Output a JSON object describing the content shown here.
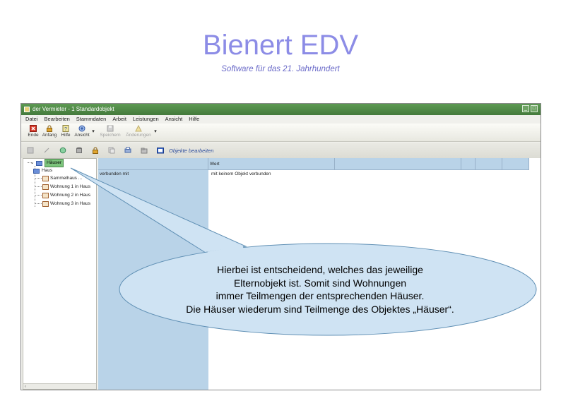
{
  "slide": {
    "title": "Bienert EDV",
    "subtitle": "Software für das 21. Jahrhundert"
  },
  "window": {
    "title": "der Vermieter - 1 Standardobjekt",
    "controls": [
      "_",
      "□"
    ]
  },
  "menu": [
    "Datei",
    "Bearbeiten",
    "Stammdaten",
    "Arbeit",
    "Leistungen",
    "Ansicht",
    "Hilfe"
  ],
  "toolbar1": {
    "buttons": [
      {
        "label": "Ende",
        "icon": "close-icon"
      },
      {
        "label": "Anfang",
        "icon": "lock-icon"
      },
      {
        "label": "Hilfe",
        "icon": "help-icon"
      },
      {
        "label": "Ansicht",
        "icon": "view-icon"
      }
    ],
    "dropdown": "▾",
    "disabled_buttons": [
      {
        "label": "Speichern",
        "icon": "save-icon"
      },
      {
        "label": "Änderungen",
        "icon": "changes-icon"
      }
    ]
  },
  "toolbar2": {
    "label": "Objekte bearbeiten",
    "icons": [
      "save-icon",
      "undo-icon",
      "refresh-icon",
      "database-icon",
      "lock-icon",
      "copy-icon",
      "print-icon",
      "folder-icon",
      "edit-icon"
    ]
  },
  "tree": {
    "root": "Häuser",
    "child": "Haus",
    "items": [
      "Sammelhaus ...",
      "Wohnung 1 in Haus",
      "Wohnung 2 in Haus",
      "Wohnung 3 in Haus"
    ],
    "scroll_arrow": "‹"
  },
  "properties": {
    "header": {
      "wert": "Wert"
    },
    "row_label": "verbunden mit",
    "row_value": "mit keinem Objekt verbunden"
  },
  "callout": {
    "lines": [
      "Hierbei ist entscheidend, welches das jeweilige",
      "Elternobjekt ist. Somit sind Wohnungen",
      "immer Teilmengen der entsprechenden Häuser.",
      "Die Häuser wiederum sind Teilmenge des Objektes „Häuser“."
    ]
  },
  "colors": {
    "title": "#8c8ce6",
    "titlebar": "#4f8a46",
    "callout_fill": "#cfe3f3",
    "callout_stroke": "#5f8fb4",
    "grid_blue": "#b9d3e8",
    "selected_node": "#7cc47c"
  }
}
